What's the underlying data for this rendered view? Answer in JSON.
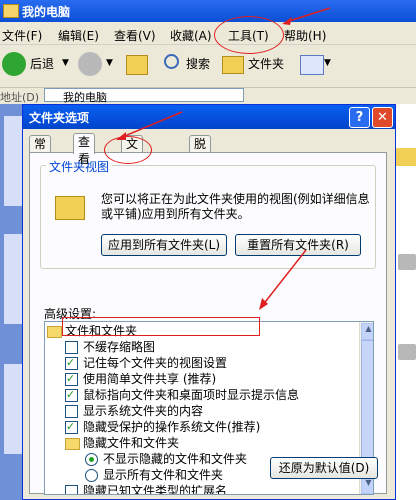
{
  "window": {
    "title": "我的电脑"
  },
  "menu": [
    "文件(F)",
    "编辑(E)",
    "查看(V)",
    "收藏(A)",
    "工具(T)",
    "帮助(H)"
  ],
  "toolbar": {
    "back": "后退",
    "search": "搜索",
    "folders": "文件夹"
  },
  "address": {
    "label": "地址(D)",
    "value": "我的电脑"
  },
  "dialog": {
    "title": "文件夹选项",
    "tabs": [
      "常规",
      "查看",
      "文件类型",
      "脱机文件"
    ],
    "active_tab": "查看",
    "folder_views": {
      "label": "文件夹视图",
      "description": "您可以将正在为此文件夹使用的视图(例如详细信息或平铺)应用到所有文件夹。",
      "apply_button": "应用到所有文件夹(L)",
      "reset_button": "重置所有文件夹(R)"
    },
    "advanced_label": "高级设置:",
    "tree": [
      {
        "type": "folder",
        "label": "文件和文件夹"
      },
      {
        "type": "checkbox",
        "checked": false,
        "label": "不缓存缩略图"
      },
      {
        "type": "checkbox",
        "checked": true,
        "label": "记住每个文件夹的视图设置"
      },
      {
        "type": "checkbox",
        "checked": true,
        "label": "使用简单文件共享 (推荐)"
      },
      {
        "type": "checkbox",
        "checked": true,
        "label": "鼠标指向文件夹和桌面项时显示提示信息"
      },
      {
        "type": "checkbox",
        "checked": false,
        "label": "显示系统文件夹的内容"
      },
      {
        "type": "checkbox",
        "checked": true,
        "label": "隐藏受保护的操作系统文件(推荐)"
      },
      {
        "type": "folder",
        "label": "隐藏文件和文件夹"
      },
      {
        "type": "radio",
        "checked": true,
        "label": "不显示隐藏的文件和文件夹"
      },
      {
        "type": "radio",
        "checked": false,
        "label": "显示所有文件和文件夹"
      },
      {
        "type": "checkbox",
        "checked": false,
        "label": "隐藏已知文件类型的扩展名"
      }
    ],
    "restore_button": "还原为默认值(D)"
  },
  "colors": {
    "accent": "#0a5ff0",
    "annotation": "#e02020",
    "check": "#21a121"
  },
  "icons": [
    "folder-icon",
    "back-arrow-icon",
    "forward-arrow-icon",
    "up-folder-icon",
    "search-icon",
    "help-icon",
    "close-icon",
    "views-icon",
    "drive-icon"
  ]
}
